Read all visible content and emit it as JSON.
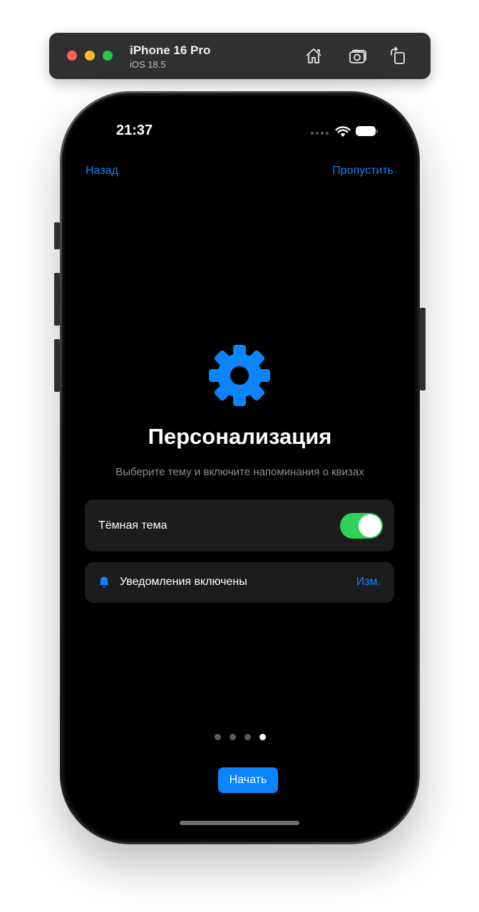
{
  "simulator": {
    "device_name": "iPhone 16 Pro",
    "os_version": "iOS 18.5",
    "toolbar_icons": [
      "home-icon",
      "screenshot-icon",
      "rotate-icon"
    ]
  },
  "status_bar": {
    "time": "21:37",
    "icons": [
      "cellular-signal-icon",
      "wifi-icon",
      "battery-icon"
    ]
  },
  "nav": {
    "back_label": "Назад",
    "skip_label": "Пропустить"
  },
  "hero": {
    "icon": "gear-icon",
    "title": "Персонализация",
    "subtitle": "Выберите тему и включите напоминания о квизах"
  },
  "settings": {
    "dark_theme_label": "Тёмная тема",
    "dark_theme_enabled": true,
    "notifications_icon": "bell-icon",
    "notifications_label": "Уведомления включены",
    "notifications_edit_label": "Изм."
  },
  "pager": {
    "total_pages": 4,
    "current_page": 4
  },
  "cta": {
    "start_label": "Начать"
  },
  "colors": {
    "accent": "#0a84ff",
    "toggle_on": "#30d158",
    "background": "#000000",
    "card": "#1c1c1e",
    "secondary_text": "#8e8e93"
  }
}
